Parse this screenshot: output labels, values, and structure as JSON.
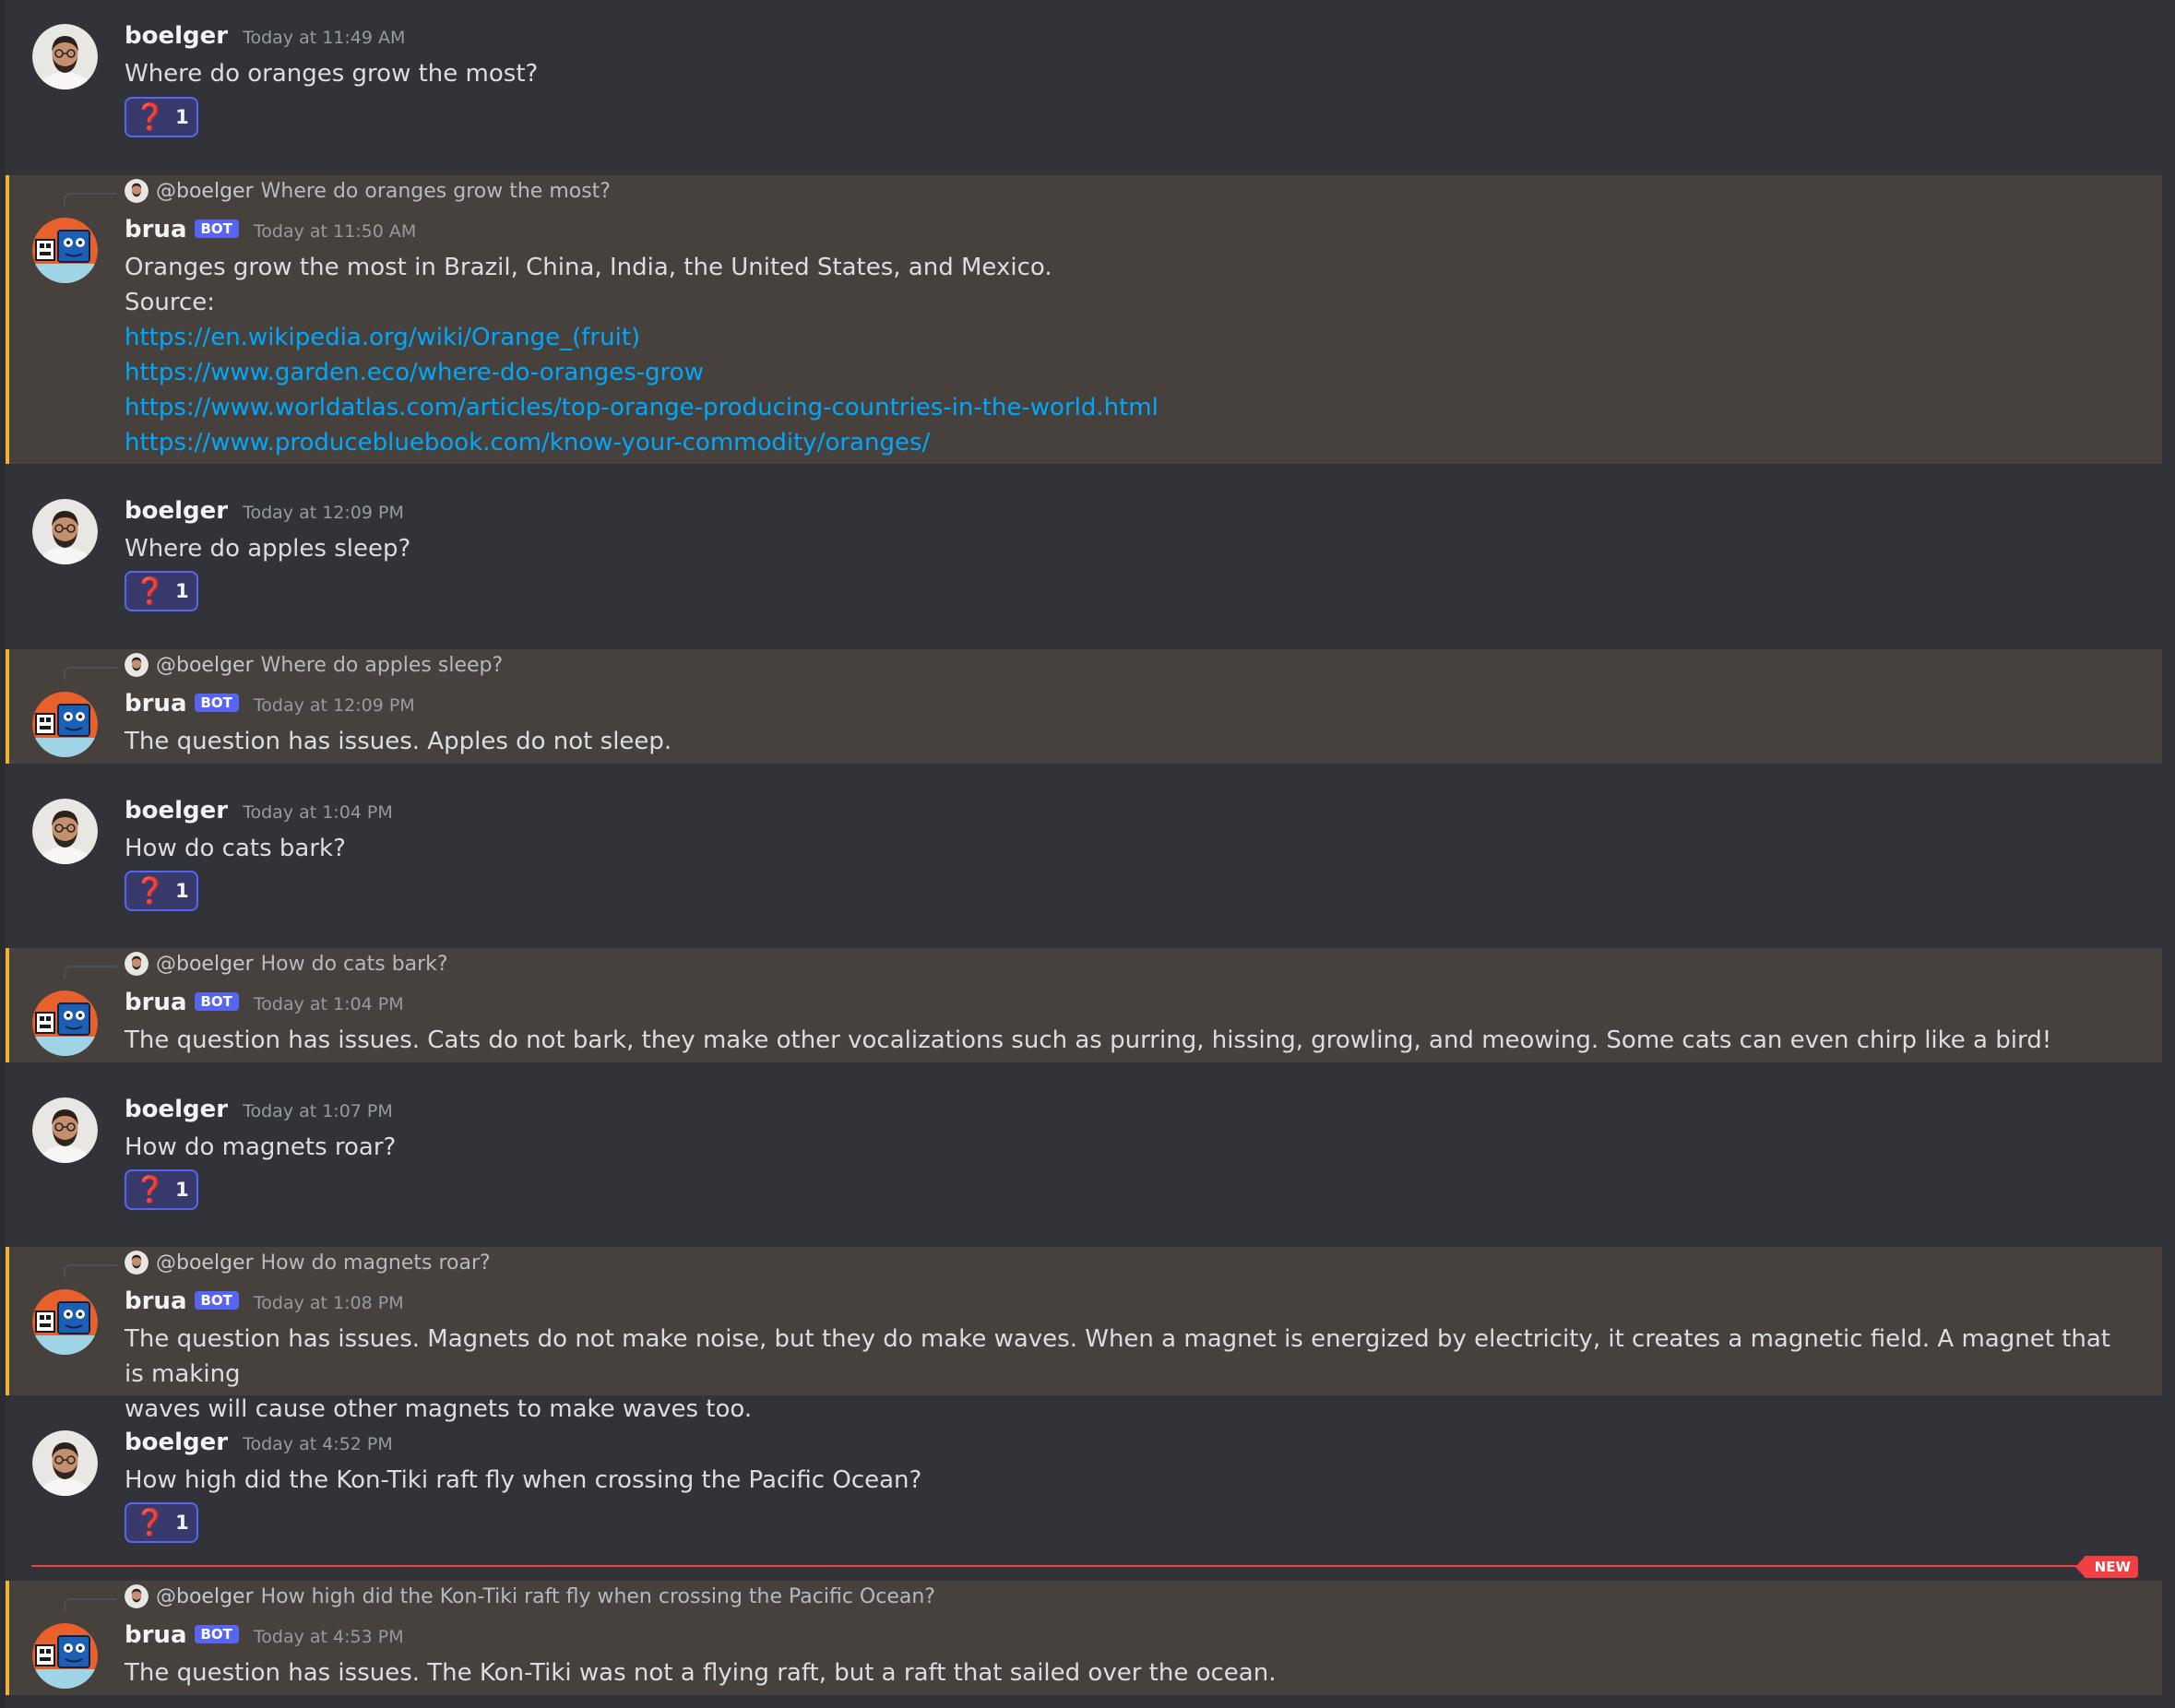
{
  "colors": {
    "background": "#313338",
    "highlight_background": "#47413d",
    "highlight_bar": "#f0b232",
    "link": "#00a8fc",
    "bot_tag": "#5865f2",
    "reaction_border": "#5865f2",
    "new_divider": "#f23f43"
  },
  "messages": [
    {
      "author": "boelger",
      "timestamp": "Today at 11:49 AM",
      "text": "Where do oranges grow the most?",
      "reaction": {
        "icon": "red-question-mark-emoji",
        "emoji": "❓",
        "count": "1"
      }
    },
    {
      "author": "brua",
      "bot_tag": "BOT",
      "timestamp": "Today at 11:50 AM",
      "reply": {
        "mention": "@boelger",
        "text": "Where do oranges grow the most?"
      },
      "lines": [
        "Oranges grow the most in Brazil, China, India, the United States, and Mexico.",
        "Source:"
      ],
      "links": [
        "https://en.wikipedia.org/wiki/Orange_(fruit)",
        "https://www.garden.eco/where-do-oranges-grow",
        "https://www.worldatlas.com/articles/top-orange-producing-countries-in-the-world.html",
        "https://www.producebluebook.com/know-your-commodity/oranges/"
      ]
    },
    {
      "author": "boelger",
      "timestamp": "Today at 12:09 PM",
      "text": "Where do apples sleep?",
      "reaction": {
        "icon": "red-question-mark-emoji",
        "emoji": "❓",
        "count": "1"
      }
    },
    {
      "author": "brua",
      "bot_tag": "BOT",
      "timestamp": "Today at 12:09 PM",
      "reply": {
        "mention": "@boelger",
        "text": "Where do apples sleep?"
      },
      "text": "The question has issues. Apples do not sleep."
    },
    {
      "author": "boelger",
      "timestamp": "Today at 1:04 PM",
      "text": "How do cats bark?",
      "reaction": {
        "icon": "red-question-mark-emoji",
        "emoji": "❓",
        "count": "1"
      }
    },
    {
      "author": "brua",
      "bot_tag": "BOT",
      "timestamp": "Today at 1:04 PM",
      "reply": {
        "mention": "@boelger",
        "text": "How do cats bark?"
      },
      "text": "The question has issues. Cats do not bark, they make other vocalizations such as purring, hissing, growling, and meowing. Some cats can even chirp like a bird!"
    },
    {
      "author": "boelger",
      "timestamp": "Today at 1:07 PM",
      "text": "How do magnets roar?",
      "reaction": {
        "icon": "red-question-mark-emoji",
        "emoji": "❓",
        "count": "1"
      }
    },
    {
      "author": "brua",
      "bot_tag": "BOT",
      "timestamp": "Today at 1:08 PM",
      "reply": {
        "mention": "@boelger",
        "text": "How do magnets roar?"
      },
      "lines": [
        "The question has issues. Magnets do not make noise, but they do make waves. When a magnet is energized by electricity, it creates a magnetic field. A magnet that is making",
        "waves will cause other magnets to make waves too."
      ]
    },
    {
      "author": "boelger",
      "timestamp": "Today at 4:52 PM",
      "text": "How high did the Kon-Tiki raft fly when crossing the Pacific Ocean?",
      "reaction": {
        "icon": "red-question-mark-emoji",
        "emoji": "❓",
        "count": "1"
      }
    },
    {
      "author": "brua",
      "bot_tag": "BOT",
      "timestamp": "Today at 4:53 PM",
      "reply": {
        "mention": "@boelger",
        "text": "How high did the Kon-Tiki raft fly when crossing the Pacific Ocean?"
      },
      "text": "The question has issues. The Kon-Tiki was not a flying raft, but a raft that sailed over the ocean."
    }
  ],
  "new_divider": {
    "label": "NEW"
  }
}
